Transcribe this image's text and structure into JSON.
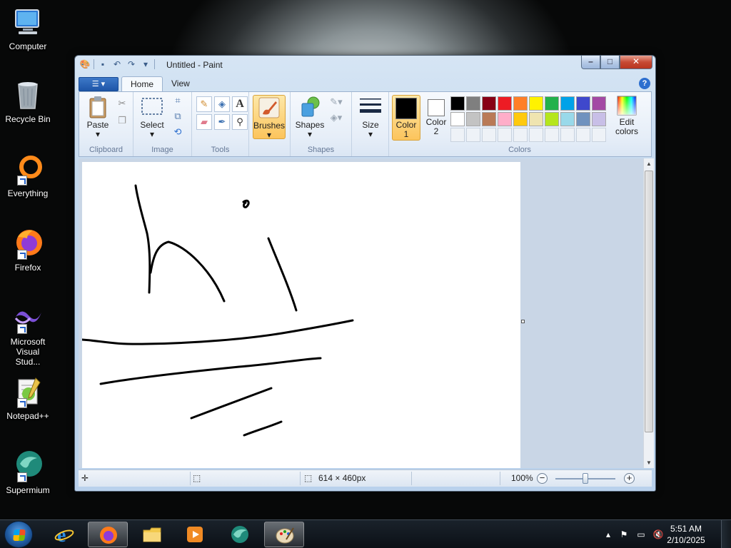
{
  "desktop": {
    "icons": [
      {
        "label": "Computer"
      },
      {
        "label": "Recycle Bin"
      },
      {
        "label": "Everything"
      },
      {
        "label": "Firefox"
      },
      {
        "label": "Microsoft Visual Stud..."
      },
      {
        "label": "Notepad++"
      },
      {
        "label": "Supermium"
      }
    ]
  },
  "window": {
    "title": "Untitled - Paint",
    "controls": {
      "minimize": "–",
      "maximize": "□",
      "close": "✕"
    }
  },
  "ribbon": {
    "file_menu": "☰ ▾",
    "tabs": [
      {
        "label": "Home"
      },
      {
        "label": "View"
      }
    ],
    "help": "?",
    "groups": {
      "clipboard": {
        "label": "Clipboard",
        "paste": "Paste"
      },
      "image": {
        "label": "Image",
        "select": "Select"
      },
      "tools": {
        "label": "Tools"
      },
      "brushes": {
        "label": "Brushes"
      },
      "shapes": {
        "label": "Shapes",
        "shapes_btn": "Shapes"
      },
      "size": {
        "label": "Size"
      },
      "colors": {
        "label": "Colors",
        "color1": "Color 1",
        "color2": "Color 2",
        "edit_colors": "Edit colors",
        "color1_value": "#000000",
        "color2_value": "#ffffff",
        "palette_row1": [
          "#000000",
          "#7f7f7f",
          "#880015",
          "#ed1c24",
          "#ff7f27",
          "#fff200",
          "#22b14c",
          "#00a2e8",
          "#3f48cc",
          "#a349a4"
        ],
        "palette_row2": [
          "#ffffff",
          "#c3c3c3",
          "#b97a57",
          "#ffaec9",
          "#ffc90e",
          "#efe4b0",
          "#b5e61d",
          "#99d9ea",
          "#7092be",
          "#c8bfe7"
        ]
      }
    }
  },
  "statusbar": {
    "image_size": "614 × 460px",
    "zoom": "100%"
  },
  "taskbar": {
    "clock_time": "5:51 AM",
    "clock_date": "2/10/2025"
  }
}
